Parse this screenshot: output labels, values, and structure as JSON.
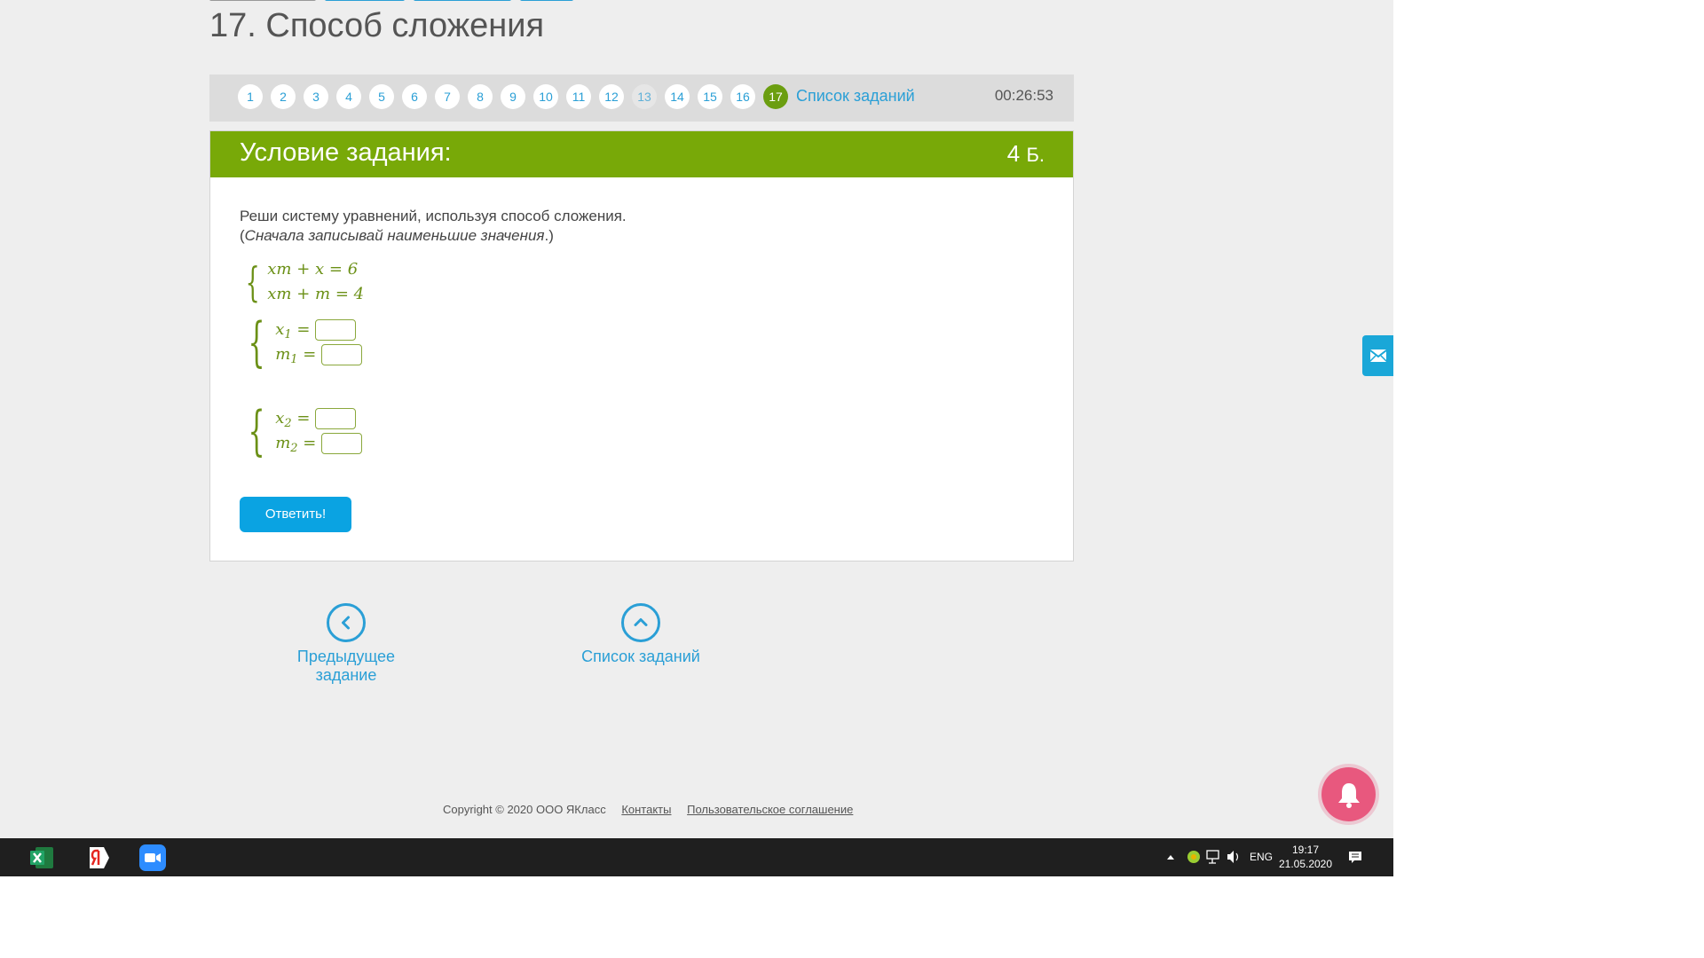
{
  "page": {
    "title": "17. Способ сложения"
  },
  "nav": {
    "numbers": [
      "1",
      "2",
      "3",
      "4",
      "5",
      "6",
      "7",
      "8",
      "9",
      "10",
      "11",
      "12",
      "13",
      "14",
      "15",
      "16",
      "17"
    ],
    "task_list": "Список заданий",
    "timer": "00:26:53"
  },
  "task": {
    "header": "Условие задания:",
    "points": "4",
    "points_unit": "Б.",
    "condition_line1": "Реши систему уравнений, используя способ сложения.",
    "condition_line2_open": "(",
    "condition_line2_italic": "Сначала записывай наименьшие значения",
    "condition_line2_close": ".)",
    "eq1": "xm + x = 6",
    "eq2": "xm + m = 4",
    "x_label": "x",
    "m_label": "m",
    "eq_sign": "=",
    "sub1": "1",
    "sub2": "2",
    "answer_button": "Ответить!"
  },
  "links": {
    "prev": "Предыдущее задание",
    "list": "Список заданий"
  },
  "footer": {
    "copyright": "Copyright © 2020 ООО ЯКласс",
    "contacts": "Контакты",
    "agreement": "Пользовательское соглашение"
  },
  "taskbar": {
    "lang": "ENG",
    "time": "19:17",
    "date": "21.05.2020"
  },
  "colors": {
    "accent_green": "#78a908",
    "link_blue": "#2a9fd6",
    "button_blue": "#0aa3e2",
    "bell_pink": "#e8587e"
  }
}
